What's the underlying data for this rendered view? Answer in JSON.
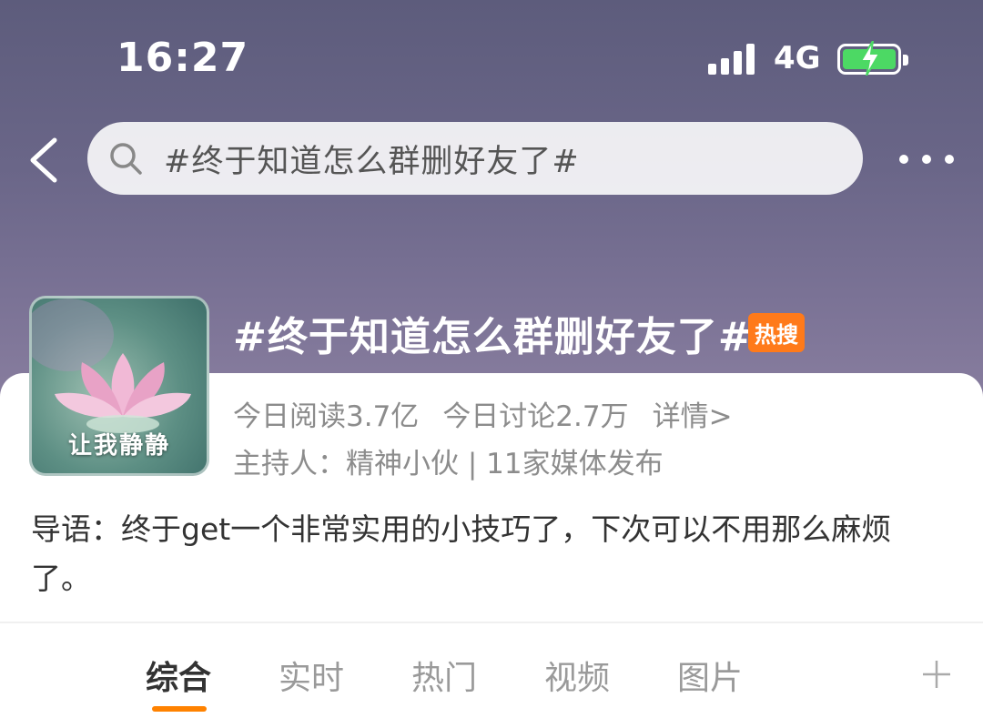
{
  "status": {
    "time": "16:27",
    "network": "4G"
  },
  "search": {
    "query": "#终于知道怎么群删好友了#"
  },
  "topic": {
    "title": "#终于知道怎么群删好友了#",
    "badge": "热搜",
    "avatar_label": "让我静静",
    "reads": "今日阅读3.7亿",
    "discussions": "今日讨论2.7万",
    "details": "详情>",
    "host_line": "主持人：精神小伙 | 11家媒体发布"
  },
  "intro": {
    "text": "导语：终于get一个非常实用的小技巧了，下次可以不用那么麻烦了。"
  },
  "tabs": [
    {
      "label": "综合"
    },
    {
      "label": "实时"
    },
    {
      "label": "热门"
    },
    {
      "label": "视频"
    },
    {
      "label": "图片"
    }
  ],
  "colors": {
    "accent": "#ff8200",
    "badge": "#ff7a1a",
    "battery": "#4cd964"
  }
}
